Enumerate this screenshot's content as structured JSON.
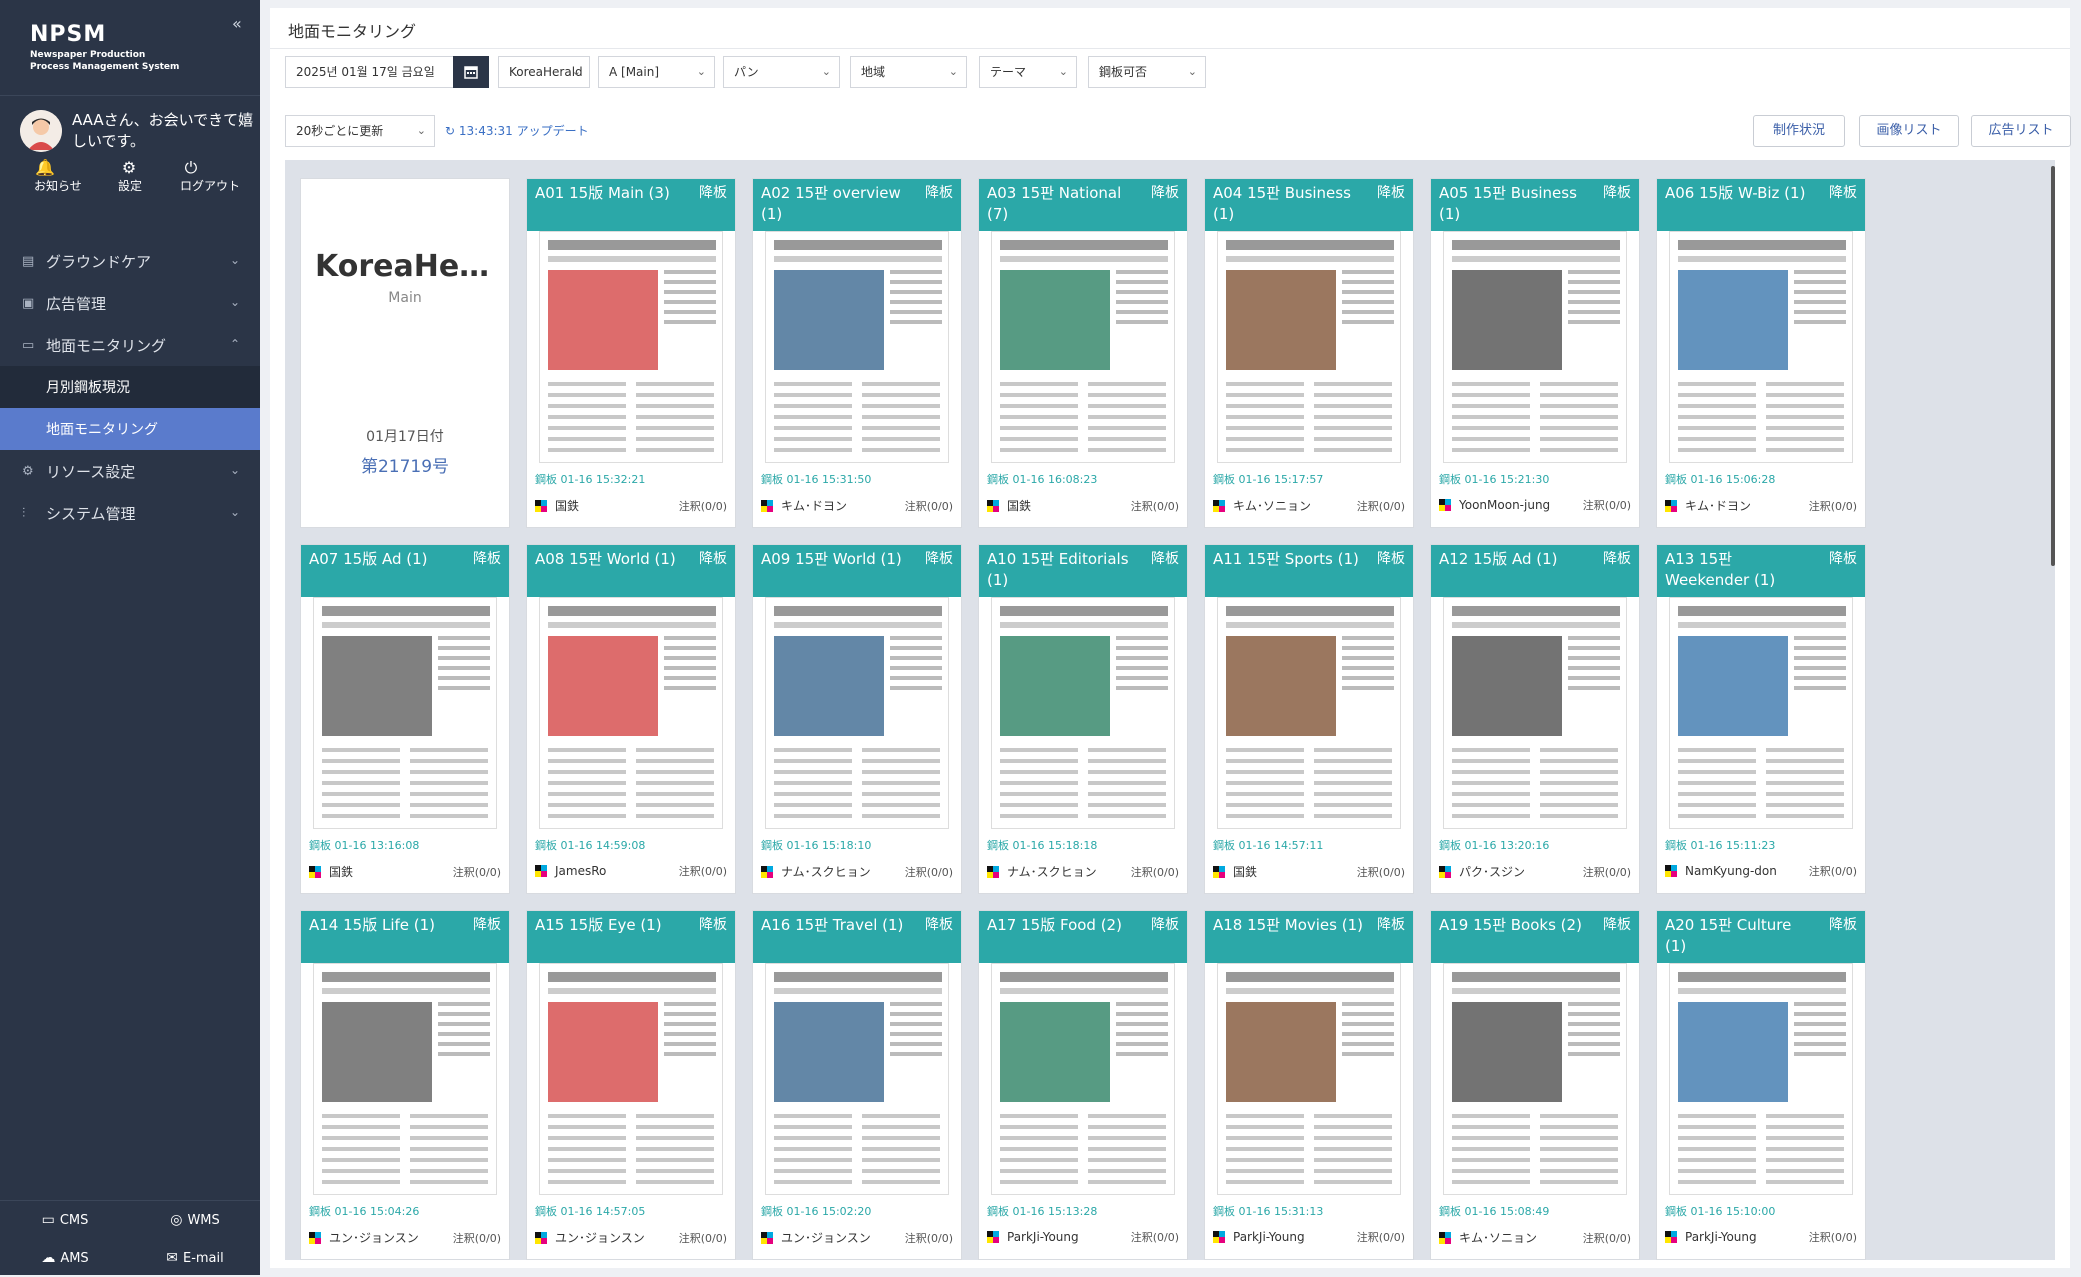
{
  "sidebar": {
    "brand_title": "NPSM",
    "brand_sub1": "Newspaper Production",
    "brand_sub2": "Process Management System",
    "collapse": "«",
    "greeting": "AAAさん、お会いできて嬉しいです。",
    "quick": [
      {
        "icon": "bell-icon",
        "label": "お知らせ"
      },
      {
        "icon": "gear-icon",
        "label": "設定"
      },
      {
        "icon": "power-icon",
        "label": "ログアウト"
      }
    ],
    "nav": [
      {
        "label": "グラウンドケア",
        "expanded": false
      },
      {
        "label": "広告管理",
        "expanded": false
      },
      {
        "label": "地面モニタリング",
        "expanded": true,
        "children": [
          "月別鋼板現況",
          "地面モニタリング"
        ]
      },
      {
        "label": "リソース設定",
        "expanded": false
      },
      {
        "label": "システム管理",
        "expanded": false
      }
    ],
    "bottom": [
      "CMS",
      "WMS",
      "AMS",
      "E-mail"
    ]
  },
  "main": {
    "title": "地面モニタリング",
    "date_value": "2025년 01월 17일 금요일",
    "selects": [
      "KoreaHerald",
      "A [Main]",
      "パン",
      "地域",
      "テーマ",
      "鋼板可否"
    ],
    "refresh": "20秒ごとに更新",
    "updated": "13:43:31 アップデート",
    "buttons": [
      "制作状況",
      "画像リスト",
      "広告リスト"
    ]
  },
  "info": {
    "name": "KoreaHer…",
    "section": "Main",
    "date": "01月17日付",
    "issue": "第21719号"
  },
  "colors": {
    "teal": "#2ba8a8",
    "sidebar": "#2b3547",
    "active": "#5a7bcc"
  },
  "pages": [
    {
      "title": "A01 15版 Main (3)",
      "status": "降板",
      "time": "鋼板 01-16 15:32:21",
      "who": "国鉄",
      "ann": "注釈(0/0)"
    },
    {
      "title": "A02 15판 overview (1)",
      "status": "降板",
      "time": "鋼板 01-16 15:31:50",
      "who": "キム･ドヨン",
      "ann": "注釈(0/0)"
    },
    {
      "title": "A03 15판 National (7)",
      "status": "降板",
      "time": "鋼板 01-16 16:08:23",
      "who": "国鉄",
      "ann": "注釈(0/0)"
    },
    {
      "title": "A04 15판 Business (1)",
      "status": "降板",
      "time": "鋼板 01-16 15:17:57",
      "who": "キム･ソニョン",
      "ann": "注釈(0/0)"
    },
    {
      "title": "A05 15판 Business (1)",
      "status": "降板",
      "time": "鋼板 01-16 15:21:30",
      "who": "YoonMoon-jung",
      "ann": "注釈(0/0)"
    },
    {
      "title": "A06 15版 W-Biz (1)",
      "status": "降板",
      "time": "鋼板 01-16 15:06:28",
      "who": "キム･ドヨン",
      "ann": "注釈(0/0)"
    },
    {
      "title": "A07 15版 Ad (1)",
      "status": "降板",
      "time": "鋼板 01-16 13:16:08",
      "who": "国鉄",
      "ann": "注釈(0/0)"
    },
    {
      "title": "A08 15판 World (1)",
      "status": "降板",
      "time": "鋼板 01-16 14:59:08",
      "who": "JamesRo",
      "ann": "注釈(0/0)"
    },
    {
      "title": "A09 15판 World (1)",
      "status": "降板",
      "time": "鋼板 01-16 15:18:10",
      "who": "ナム･スクヒョン",
      "ann": "注釈(0/0)"
    },
    {
      "title": "A10 15판 Editorials (1)",
      "status": "降板",
      "time": "鋼板 01-16 15:18:18",
      "who": "ナム･スクヒョン",
      "ann": "注釈(0/0)"
    },
    {
      "title": "A11 15판 Sports (1)",
      "status": "降板",
      "time": "鋼板 01-16 14:57:11",
      "who": "国鉄",
      "ann": "注釈(0/0)"
    },
    {
      "title": "A12 15版 Ad (1)",
      "status": "降板",
      "time": "鋼板 01-16 13:20:16",
      "who": "パク･スジン",
      "ann": "注釈(0/0)"
    },
    {
      "title": "A13 15판 Weekender (1)",
      "status": "降板",
      "time": "鋼板 01-16 15:11:23",
      "who": "NamKyung-don",
      "ann": "注釈(0/0)"
    },
    {
      "title": "A14 15版 Life (1)",
      "status": "降板",
      "time": "鋼板 01-16 15:04:26",
      "who": "ユン･ジョンスン",
      "ann": "注釈(0/0)"
    },
    {
      "title": "A15 15版 Eye (1)",
      "status": "降板",
      "time": "鋼板 01-16 14:57:05",
      "who": "ユン･ジョンスン",
      "ann": "注釈(0/0)"
    },
    {
      "title": "A16 15판 Travel (1)",
      "status": "降板",
      "time": "鋼板 01-16 15:02:20",
      "who": "ユン･ジョンスン",
      "ann": "注釈(0/0)"
    },
    {
      "title": "A17 15版 Food (2)",
      "status": "降板",
      "time": "鋼板 01-16 15:13:28",
      "who": "ParkJi-Young",
      "ann": "注釈(0/0)"
    },
    {
      "title": "A18 15판 Movies (1)",
      "status": "降板",
      "time": "鋼板 01-16 15:31:13",
      "who": "ParkJi-Young",
      "ann": "注釈(0/0)"
    },
    {
      "title": "A19 15판 Books (2)",
      "status": "降板",
      "time": "鋼板 01-16 15:08:49",
      "who": "キム･ソニョン",
      "ann": "注釈(0/0)"
    },
    {
      "title": "A20 15판 Culture (1)",
      "status": "降板",
      "time": "鋼板 01-16 15:10:00",
      "who": "ParkJi-Young",
      "ann": "注釈(0/0)"
    }
  ]
}
